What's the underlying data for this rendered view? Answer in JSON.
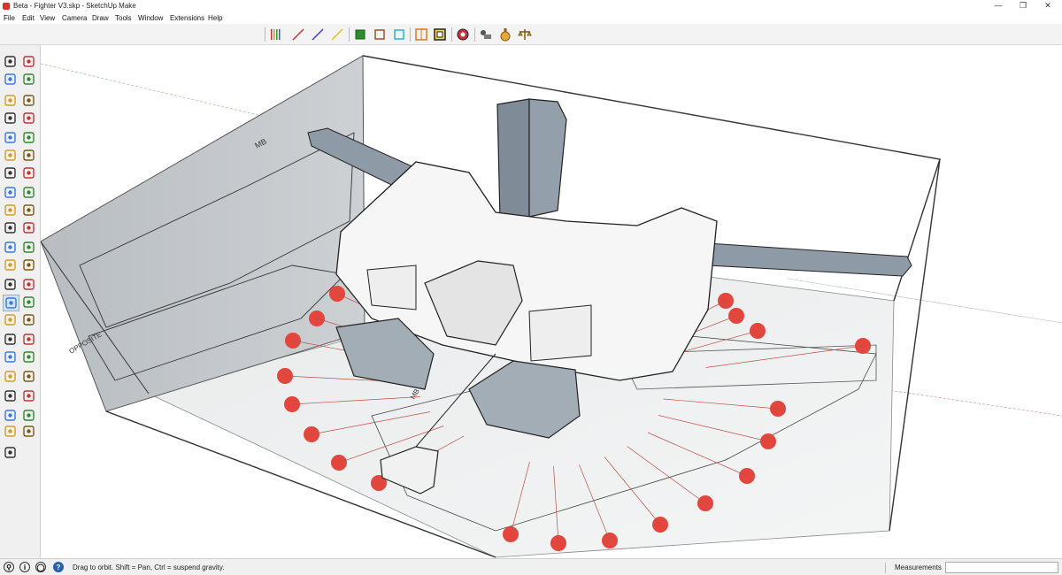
{
  "window": {
    "title": "Beta - Fighter V3.skp - SketchUp Make",
    "minimize_glyph": "—",
    "restore_glyph": "❐",
    "close_glyph": "✕"
  },
  "menu": [
    "File",
    "Edit",
    "View",
    "Camera",
    "Draw",
    "Tools",
    "Window",
    "Extensions",
    "Help"
  ],
  "toolbar": {
    "icons": [
      "line-weight-icon",
      "line-red-icon",
      "line-blue-icon",
      "line-yellow-icon",
      "component-green-icon",
      "box-outline-icon",
      "box-cyan-icon",
      "section-orange-icon",
      "section-black-icon",
      "ruby-icon",
      "model-info-icon",
      "potion-icon",
      "scales-icon"
    ]
  },
  "left_toolbar": {
    "tools": [
      "select-icon",
      "make-component-icon",
      "paint-bucket-icon",
      "eraser-icon",
      "pencil-icon",
      "freehand-icon",
      "rectangle-icon",
      "rotated-rectangle-icon",
      "circle-icon",
      "polygon-icon",
      "arc-icon",
      "two-point-arc-icon",
      "three-point-arc-icon",
      "pie-icon",
      "move-icon",
      "push-pull-icon",
      "rotate-icon",
      "follow-me-icon",
      "scale-icon",
      "offset-icon",
      "tape-measure-icon",
      "dimension-icon",
      "protractor-icon",
      "text-icon",
      "axes-icon",
      "3d-text-icon",
      "orbit-icon",
      "pan-icon",
      "zoom-icon",
      "zoom-window-icon",
      "zoom-extents-icon",
      "previous-view-icon",
      "position-camera-icon",
      "look-around-icon",
      "walk-icon",
      "section-plane-icon",
      "iso-view-icon",
      "top-view-icon",
      "front-view-icon",
      "right-view-icon",
      "back-view-icon",
      "left-view-icon",
      "layers-icon"
    ]
  },
  "viewport": {
    "blueprint_labels": [
      "MB",
      "OPPOSITE",
      "MB"
    ]
  },
  "statusbar": {
    "hint": "Drag to orbit. Shift = Pan, Ctrl = suspend gravity.",
    "measurements_label": "Measurements",
    "measurements_value": ""
  },
  "colors": {
    "axis_red": "#c83232",
    "accent_blue": "#3b78d8",
    "plane_gray": "#9fa6ad",
    "callout_red": "#e2463c"
  }
}
